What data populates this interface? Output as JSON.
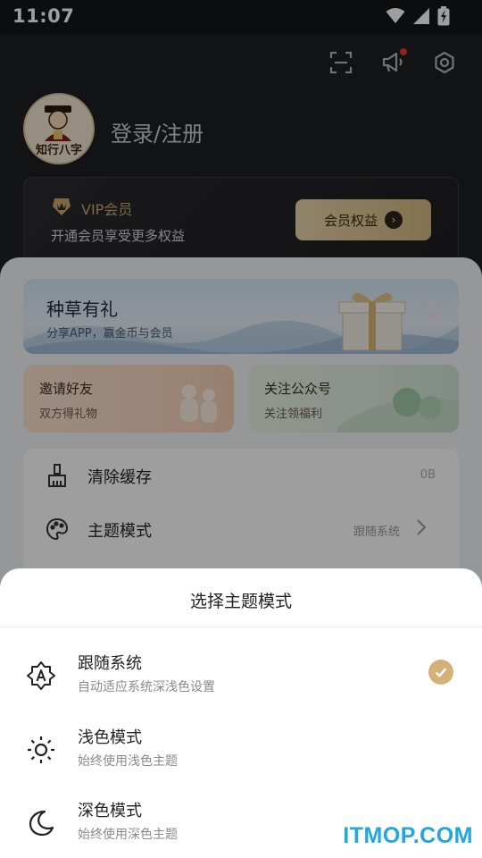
{
  "status_bar": {
    "time": "11:07"
  },
  "profile": {
    "avatar_text": "知行八字",
    "login_label": "登录/注册"
  },
  "vip": {
    "title": "VIP会员",
    "subtitle": "开通会员享受更多权益",
    "button_label": "会员权益"
  },
  "banners": {
    "main": {
      "title": "种草有礼",
      "subtitle": "分享APP，赢金币与会员"
    },
    "invite": {
      "title": "邀请好友",
      "subtitle": "双方得礼物"
    },
    "follow": {
      "title": "关注公众号",
      "subtitle": "关注领福利"
    }
  },
  "settings": [
    {
      "label": "清除缓存",
      "value": "0B",
      "icon": "broom-icon"
    },
    {
      "label": "主题模式",
      "value": "跟随系统",
      "icon": "palette-icon"
    }
  ],
  "sheet": {
    "title": "选择主题模式",
    "options": [
      {
        "title": "跟随系统",
        "subtitle": "自动适应系统深浅色设置",
        "icon": "auto-mode-icon",
        "selected": true
      },
      {
        "title": "浅色模式",
        "subtitle": "始终使用浅色主题",
        "icon": "sun-icon",
        "selected": false
      },
      {
        "title": "深色模式",
        "subtitle": "始终使用深色主题",
        "icon": "moon-icon",
        "selected": false
      }
    ]
  },
  "watermark": "ITMOP.COM",
  "colors": {
    "accent_gold": "#d3b27a",
    "vip_gold": "#c9a86a",
    "dark_bg": "#1e1f22"
  }
}
